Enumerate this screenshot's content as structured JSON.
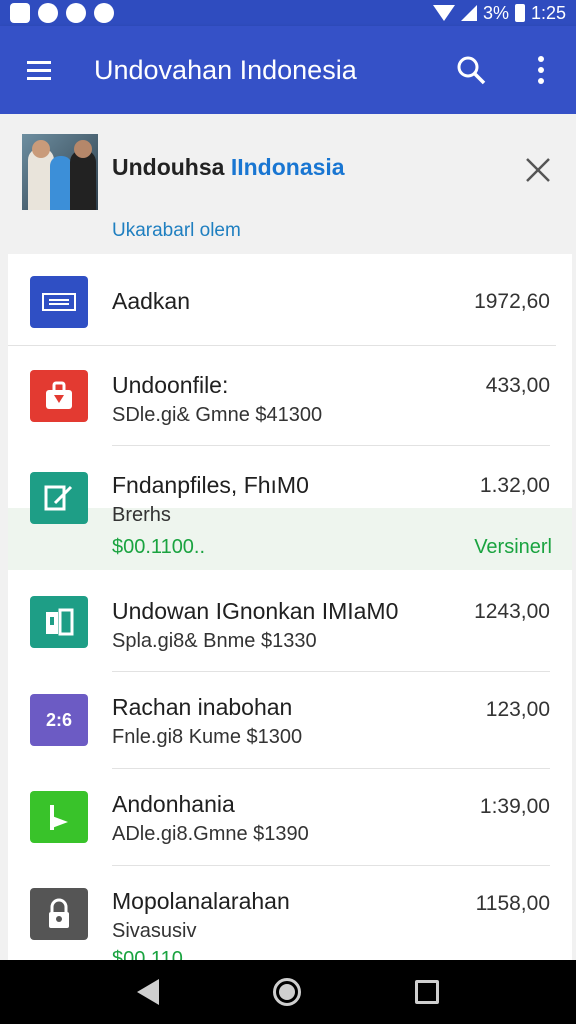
{
  "status_bar": {
    "battery": "3%",
    "time": "1:25"
  },
  "app_bar": {
    "title": "Undovahan Indonesia",
    "menu_icon": "menu-icon",
    "search_icon": "search-icon",
    "more_icon": "more-vert-icon"
  },
  "header": {
    "name_part1": "Undouhsa ",
    "name_part2": "IIndonasia",
    "link": "Ukarabarl olem"
  },
  "rows": [
    {
      "title": "Aadkan",
      "amount": "1972,60",
      "icon": "document-icon",
      "color": "#2f4fc4"
    },
    {
      "title": "Undoonfile:",
      "subtitle": "SDle.gi& Gmne $41300",
      "amount": "433,00",
      "icon": "bag-icon",
      "color": "#e33a31"
    },
    {
      "title": "Fndanpfiles, FhıM0",
      "subtitle": "Brerhs",
      "green_text": "$00.1100..",
      "version": "Versinerl",
      "amount": "1.32,00",
      "icon": "edit-icon",
      "color": "#1e9e86"
    },
    {
      "title": "Undowan IGnonkan IMIaM0",
      "subtitle": "Spla.gi8& Bnme $1330",
      "amount": "1243,00",
      "icon": "files-icon",
      "color": "#1e9e86"
    },
    {
      "title": "Rachan inabohan",
      "subtitle": "Fnle.gi8 Kume $1300",
      "amount": "123,00",
      "icon": "numbers-icon",
      "icon_text": "2:6",
      "color": "#6c5bc4"
    },
    {
      "title": "Andonhania",
      "subtitle": "ADle.gi8.Gmne $1390",
      "amount": "1:39,00",
      "icon": "flag-icon",
      "color": "#39c32a"
    },
    {
      "title": "Mopolanalarahan",
      "subtitle": "Sivasusiv",
      "green_text": "$00,110",
      "amount": "1158,00",
      "icon": "lock-icon",
      "color": "#555555"
    }
  ]
}
